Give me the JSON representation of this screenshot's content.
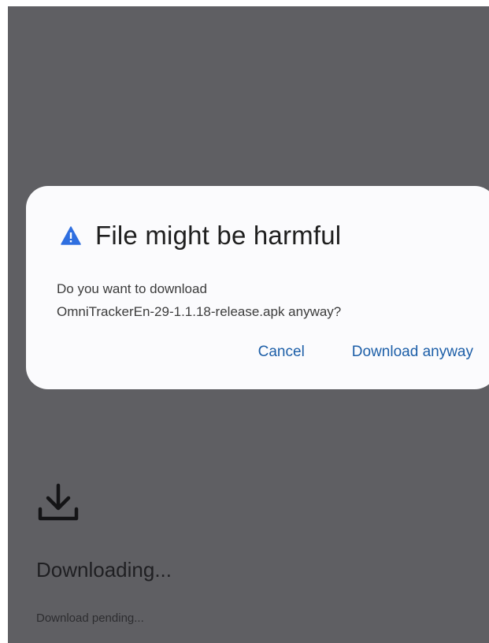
{
  "dialog": {
    "title": "File might be harmful",
    "icon": "warning-triangle-icon",
    "message_line1": "Do you want to download",
    "message_line2": "OmniTrackerEn-29-1.1.18-release.apk anyway?",
    "cancel_label": "Cancel",
    "confirm_label": "Download anyway"
  },
  "download": {
    "icon": "download-icon",
    "title": "Downloading...",
    "status": "Download pending..."
  },
  "colors": {
    "scrim": "#5f5f63",
    "dialog_background": "#fbfbfd",
    "accent": "#1d5fa8",
    "warning_icon": "#2f6fe0"
  }
}
